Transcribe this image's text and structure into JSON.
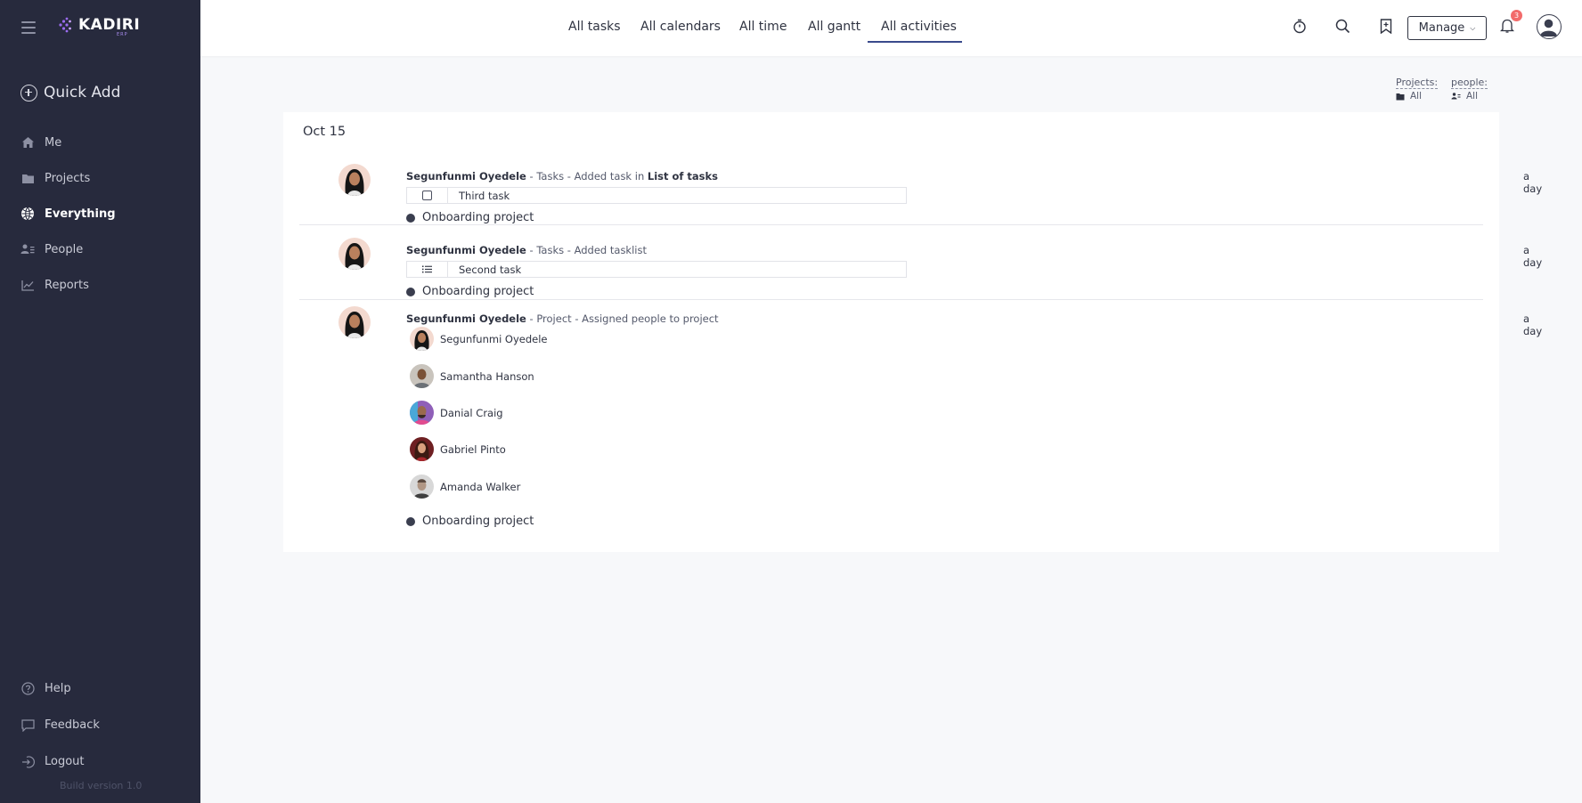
{
  "app": {
    "logo_text": "KADIRI",
    "logo_sub": "ERP",
    "build": "Build version 1.0"
  },
  "sidebar": {
    "quick_add": "Quick Add",
    "items": [
      {
        "label": "Me",
        "icon": "home-icon"
      },
      {
        "label": "Projects",
        "icon": "folder-icon"
      },
      {
        "label": "Everything",
        "icon": "everything-icon",
        "active": true
      },
      {
        "label": "People",
        "icon": "people-icon"
      },
      {
        "label": "Reports",
        "icon": "chart-icon"
      }
    ],
    "bottom": [
      {
        "label": "Help",
        "icon": "help-icon"
      },
      {
        "label": "Feedback",
        "icon": "feedback-icon"
      },
      {
        "label": "Logout",
        "icon": "logout-icon"
      }
    ]
  },
  "topbar": {
    "tabs": [
      "All tasks",
      "All calendars",
      "All time",
      "All gantt",
      "All activities"
    ],
    "active_tab": "All activities",
    "manage_label": "Manage",
    "notification_count": "3"
  },
  "filters": {
    "projects": {
      "label": "Projects:",
      "value": "All"
    },
    "people": {
      "label": "people:",
      "value": "All"
    }
  },
  "activity": {
    "date": "Oct 15",
    "entries": [
      {
        "actor": "Segunfunmi Oyedele",
        "separator": " - ",
        "module": "Tasks",
        "action": "Added task in",
        "target": "List of tasks",
        "time": "a day",
        "task": "Third task",
        "project": "Onboarding project"
      },
      {
        "actor": "Segunfunmi Oyedele",
        "separator": " - ",
        "module": "Tasks",
        "action": "Added tasklist",
        "time": "a day",
        "task": "Second task",
        "project": "Onboarding project"
      },
      {
        "actor": "Segunfunmi Oyedele",
        "separator": " - ",
        "module": "Project",
        "action": "Assigned people to project",
        "time": "a day",
        "people": [
          "Segunfunmi Oyedele",
          "Samantha Hanson",
          "Danial Craig",
          "Gabriel Pinto",
          "Amanda Walker"
        ],
        "project": "Onboarding project"
      }
    ]
  },
  "colors": {
    "sidebar_bg": "#272a3d",
    "accent": "#3a4a8c",
    "badge": "#f26b6b"
  }
}
